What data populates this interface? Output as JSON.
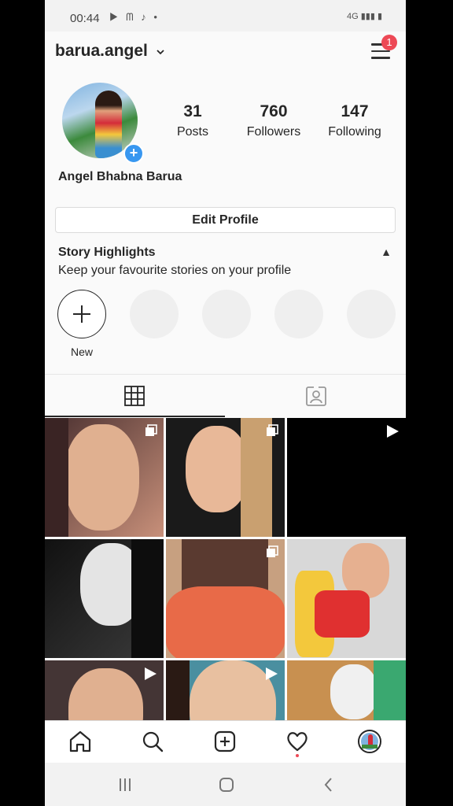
{
  "status_bar": {
    "time": "00:44",
    "left_icons": "▶ ᗰ ♪ •",
    "right_icons": "4G ▮▮▮ ▮"
  },
  "header": {
    "username": "barua.angel",
    "notification_count": "1"
  },
  "profile": {
    "full_name": "Angel Bhabna Barua",
    "stats": [
      {
        "value": "31",
        "label": "Posts"
      },
      {
        "value": "760",
        "label": "Followers"
      },
      {
        "value": "147",
        "label": "Following"
      }
    ],
    "edit_profile_label": "Edit Profile"
  },
  "highlights": {
    "title": "Story Highlights",
    "subtitle": "Keep your favourite stories on your profile",
    "new_label": "New"
  },
  "tabs": [
    {
      "name": "grid-icon",
      "active": true
    },
    {
      "name": "tagged-icon",
      "active": false
    }
  ],
  "grid": [
    {
      "type": "carousel",
      "colors": [
        "#3a2a2a",
        "#e0b090"
      ]
    },
    {
      "type": "carousel",
      "colors": [
        "#1a1a1a",
        "#e8b898"
      ]
    },
    {
      "type": "video",
      "colors": [
        "#000000",
        "#000000"
      ]
    },
    {
      "type": "image",
      "colors": [
        "#111111",
        "#f0f0f0"
      ]
    },
    {
      "type": "carousel",
      "colors": [
        "#c7a080",
        "#e86a48"
      ]
    },
    {
      "type": "image",
      "colors": [
        "#d8d8d8",
        "#e03030"
      ]
    },
    {
      "type": "video",
      "colors": [
        "#443535",
        "#e0b090"
      ]
    },
    {
      "type": "video",
      "colors": [
        "#4a8fa0",
        "#e8c0a0"
      ]
    },
    {
      "type": "image",
      "colors": [
        "#c89050",
        "#f0f0f0"
      ]
    }
  ],
  "bottom_nav": [
    "home-icon",
    "search-icon",
    "new-post-icon",
    "activity-icon",
    "profile-avatar"
  ],
  "accent_colors": {
    "notification": "#ed4956",
    "add_blue": "#3897f0"
  }
}
